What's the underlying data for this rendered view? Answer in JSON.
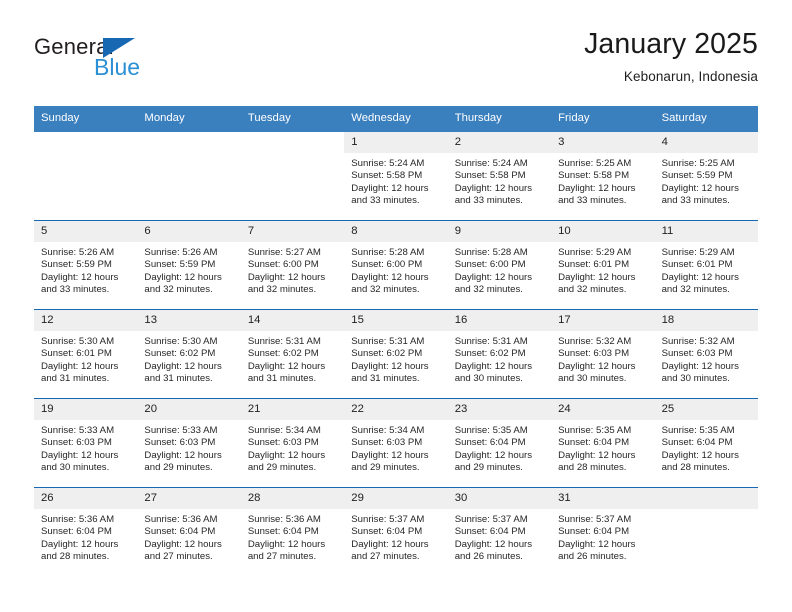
{
  "brand": {
    "word_general": "General",
    "word_blue": "Blue",
    "triangle_color": "#1668b3",
    "blue_text_color": "#2a8fd4"
  },
  "header": {
    "title": "January 2025",
    "subtitle": "Kebonarun, Indonesia"
  },
  "colors": {
    "header_row_bg": "#3a7fbe",
    "week_separator": "#1668b3",
    "day_number_bg": "#efefef"
  },
  "weekdays": [
    "Sunday",
    "Monday",
    "Tuesday",
    "Wednesday",
    "Thursday",
    "Friday",
    "Saturday"
  ],
  "weeks": [
    [
      {
        "day": "",
        "sunrise": "",
        "sunset": "",
        "daylight_line1": "",
        "daylight_line2": "",
        "empty": true,
        "gray": false
      },
      {
        "day": "",
        "sunrise": "",
        "sunset": "",
        "daylight_line1": "",
        "daylight_line2": "",
        "empty": true,
        "gray": false
      },
      {
        "day": "",
        "sunrise": "",
        "sunset": "",
        "daylight_line1": "",
        "daylight_line2": "",
        "empty": true,
        "gray": false
      },
      {
        "day": "1",
        "sunrise": "Sunrise: 5:24 AM",
        "sunset": "Sunset: 5:58 PM",
        "daylight_line1": "Daylight: 12 hours",
        "daylight_line2": "and 33 minutes.",
        "empty": false,
        "gray": true
      },
      {
        "day": "2",
        "sunrise": "Sunrise: 5:24 AM",
        "sunset": "Sunset: 5:58 PM",
        "daylight_line1": "Daylight: 12 hours",
        "daylight_line2": "and 33 minutes.",
        "empty": false,
        "gray": true
      },
      {
        "day": "3",
        "sunrise": "Sunrise: 5:25 AM",
        "sunset": "Sunset: 5:58 PM",
        "daylight_line1": "Daylight: 12 hours",
        "daylight_line2": "and 33 minutes.",
        "empty": false,
        "gray": true
      },
      {
        "day": "4",
        "sunrise": "Sunrise: 5:25 AM",
        "sunset": "Sunset: 5:59 PM",
        "daylight_line1": "Daylight: 12 hours",
        "daylight_line2": "and 33 minutes.",
        "empty": false,
        "gray": true
      }
    ],
    [
      {
        "day": "5",
        "sunrise": "Sunrise: 5:26 AM",
        "sunset": "Sunset: 5:59 PM",
        "daylight_line1": "Daylight: 12 hours",
        "daylight_line2": "and 33 minutes.",
        "empty": false,
        "gray": true
      },
      {
        "day": "6",
        "sunrise": "Sunrise: 5:26 AM",
        "sunset": "Sunset: 5:59 PM",
        "daylight_line1": "Daylight: 12 hours",
        "daylight_line2": "and 32 minutes.",
        "empty": false,
        "gray": true
      },
      {
        "day": "7",
        "sunrise": "Sunrise: 5:27 AM",
        "sunset": "Sunset: 6:00 PM",
        "daylight_line1": "Daylight: 12 hours",
        "daylight_line2": "and 32 minutes.",
        "empty": false,
        "gray": true
      },
      {
        "day": "8",
        "sunrise": "Sunrise: 5:28 AM",
        "sunset": "Sunset: 6:00 PM",
        "daylight_line1": "Daylight: 12 hours",
        "daylight_line2": "and 32 minutes.",
        "empty": false,
        "gray": true
      },
      {
        "day": "9",
        "sunrise": "Sunrise: 5:28 AM",
        "sunset": "Sunset: 6:00 PM",
        "daylight_line1": "Daylight: 12 hours",
        "daylight_line2": "and 32 minutes.",
        "empty": false,
        "gray": true
      },
      {
        "day": "10",
        "sunrise": "Sunrise: 5:29 AM",
        "sunset": "Sunset: 6:01 PM",
        "daylight_line1": "Daylight: 12 hours",
        "daylight_line2": "and 32 minutes.",
        "empty": false,
        "gray": true
      },
      {
        "day": "11",
        "sunrise": "Sunrise: 5:29 AM",
        "sunset": "Sunset: 6:01 PM",
        "daylight_line1": "Daylight: 12 hours",
        "daylight_line2": "and 32 minutes.",
        "empty": false,
        "gray": true
      }
    ],
    [
      {
        "day": "12",
        "sunrise": "Sunrise: 5:30 AM",
        "sunset": "Sunset: 6:01 PM",
        "daylight_line1": "Daylight: 12 hours",
        "daylight_line2": "and 31 minutes.",
        "empty": false,
        "gray": true
      },
      {
        "day": "13",
        "sunrise": "Sunrise: 5:30 AM",
        "sunset": "Sunset: 6:02 PM",
        "daylight_line1": "Daylight: 12 hours",
        "daylight_line2": "and 31 minutes.",
        "empty": false,
        "gray": true
      },
      {
        "day": "14",
        "sunrise": "Sunrise: 5:31 AM",
        "sunset": "Sunset: 6:02 PM",
        "daylight_line1": "Daylight: 12 hours",
        "daylight_line2": "and 31 minutes.",
        "empty": false,
        "gray": true
      },
      {
        "day": "15",
        "sunrise": "Sunrise: 5:31 AM",
        "sunset": "Sunset: 6:02 PM",
        "daylight_line1": "Daylight: 12 hours",
        "daylight_line2": "and 31 minutes.",
        "empty": false,
        "gray": true
      },
      {
        "day": "16",
        "sunrise": "Sunrise: 5:31 AM",
        "sunset": "Sunset: 6:02 PM",
        "daylight_line1": "Daylight: 12 hours",
        "daylight_line2": "and 30 minutes.",
        "empty": false,
        "gray": true
      },
      {
        "day": "17",
        "sunrise": "Sunrise: 5:32 AM",
        "sunset": "Sunset: 6:03 PM",
        "daylight_line1": "Daylight: 12 hours",
        "daylight_line2": "and 30 minutes.",
        "empty": false,
        "gray": true
      },
      {
        "day": "18",
        "sunrise": "Sunrise: 5:32 AM",
        "sunset": "Sunset: 6:03 PM",
        "daylight_line1": "Daylight: 12 hours",
        "daylight_line2": "and 30 minutes.",
        "empty": false,
        "gray": true
      }
    ],
    [
      {
        "day": "19",
        "sunrise": "Sunrise: 5:33 AM",
        "sunset": "Sunset: 6:03 PM",
        "daylight_line1": "Daylight: 12 hours",
        "daylight_line2": "and 30 minutes.",
        "empty": false,
        "gray": true
      },
      {
        "day": "20",
        "sunrise": "Sunrise: 5:33 AM",
        "sunset": "Sunset: 6:03 PM",
        "daylight_line1": "Daylight: 12 hours",
        "daylight_line2": "and 29 minutes.",
        "empty": false,
        "gray": true
      },
      {
        "day": "21",
        "sunrise": "Sunrise: 5:34 AM",
        "sunset": "Sunset: 6:03 PM",
        "daylight_line1": "Daylight: 12 hours",
        "daylight_line2": "and 29 minutes.",
        "empty": false,
        "gray": true
      },
      {
        "day": "22",
        "sunrise": "Sunrise: 5:34 AM",
        "sunset": "Sunset: 6:03 PM",
        "daylight_line1": "Daylight: 12 hours",
        "daylight_line2": "and 29 minutes.",
        "empty": false,
        "gray": true
      },
      {
        "day": "23",
        "sunrise": "Sunrise: 5:35 AM",
        "sunset": "Sunset: 6:04 PM",
        "daylight_line1": "Daylight: 12 hours",
        "daylight_line2": "and 29 minutes.",
        "empty": false,
        "gray": true
      },
      {
        "day": "24",
        "sunrise": "Sunrise: 5:35 AM",
        "sunset": "Sunset: 6:04 PM",
        "daylight_line1": "Daylight: 12 hours",
        "daylight_line2": "and 28 minutes.",
        "empty": false,
        "gray": true
      },
      {
        "day": "25",
        "sunrise": "Sunrise: 5:35 AM",
        "sunset": "Sunset: 6:04 PM",
        "daylight_line1": "Daylight: 12 hours",
        "daylight_line2": "and 28 minutes.",
        "empty": false,
        "gray": true
      }
    ],
    [
      {
        "day": "26",
        "sunrise": "Sunrise: 5:36 AM",
        "sunset": "Sunset: 6:04 PM",
        "daylight_line1": "Daylight: 12 hours",
        "daylight_line2": "and 28 minutes.",
        "empty": false,
        "gray": true
      },
      {
        "day": "27",
        "sunrise": "Sunrise: 5:36 AM",
        "sunset": "Sunset: 6:04 PM",
        "daylight_line1": "Daylight: 12 hours",
        "daylight_line2": "and 27 minutes.",
        "empty": false,
        "gray": true
      },
      {
        "day": "28",
        "sunrise": "Sunrise: 5:36 AM",
        "sunset": "Sunset: 6:04 PM",
        "daylight_line1": "Daylight: 12 hours",
        "daylight_line2": "and 27 minutes.",
        "empty": false,
        "gray": true
      },
      {
        "day": "29",
        "sunrise": "Sunrise: 5:37 AM",
        "sunset": "Sunset: 6:04 PM",
        "daylight_line1": "Daylight: 12 hours",
        "daylight_line2": "and 27 minutes.",
        "empty": false,
        "gray": true
      },
      {
        "day": "30",
        "sunrise": "Sunrise: 5:37 AM",
        "sunset": "Sunset: 6:04 PM",
        "daylight_line1": "Daylight: 12 hours",
        "daylight_line2": "and 26 minutes.",
        "empty": false,
        "gray": true
      },
      {
        "day": "31",
        "sunrise": "Sunrise: 5:37 AM",
        "sunset": "Sunset: 6:04 PM",
        "daylight_line1": "Daylight: 12 hours",
        "daylight_line2": "and 26 minutes.",
        "empty": false,
        "gray": true
      },
      {
        "day": "",
        "sunrise": "",
        "sunset": "",
        "daylight_line1": "",
        "daylight_line2": "",
        "empty": true,
        "gray": true
      }
    ]
  ]
}
